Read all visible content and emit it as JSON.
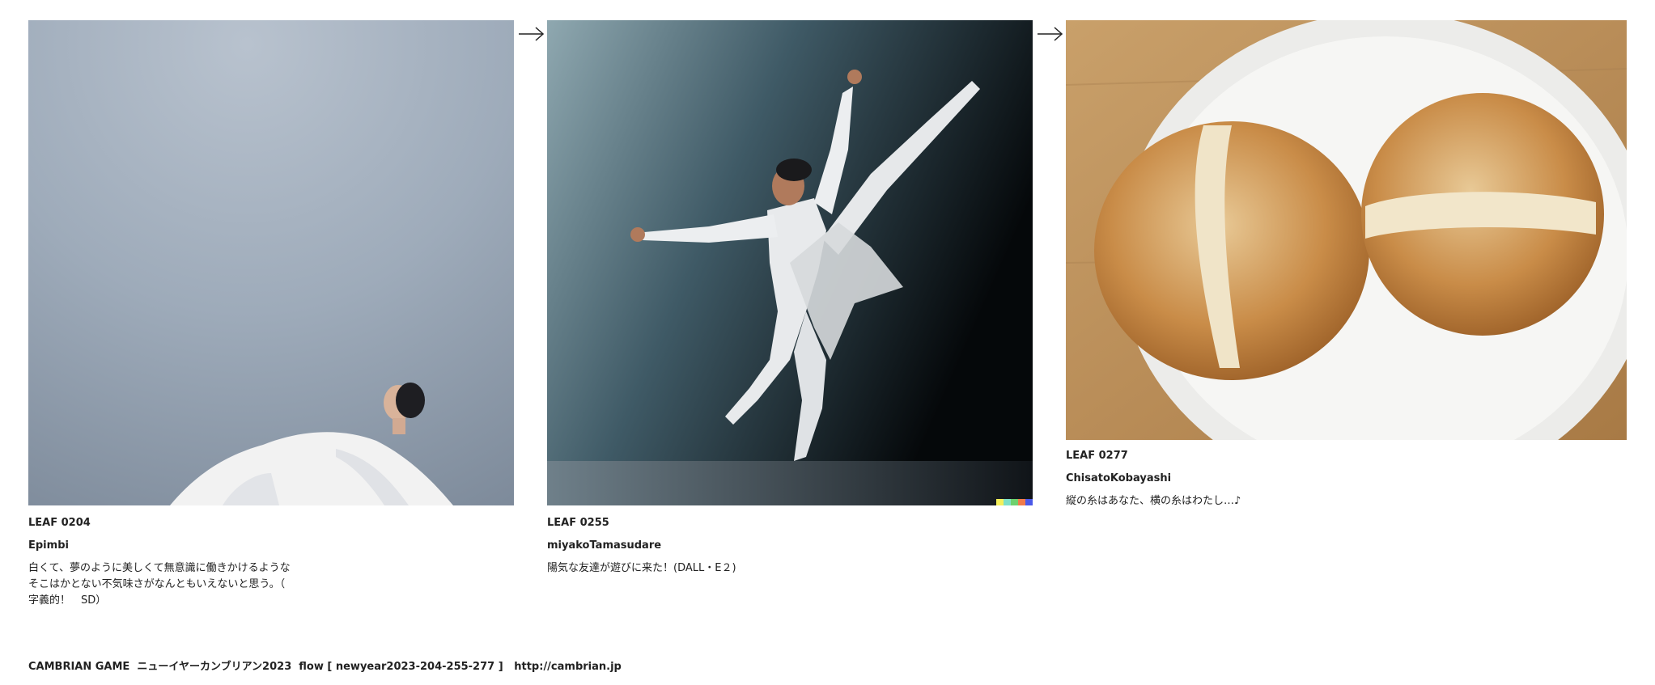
{
  "cards": [
    {
      "leaf": "LEAF 0204",
      "author": "Epimbi",
      "caption": "白くて、夢のように美しくて無意識に働きかけるような\nそこはかとない不気味さがなんともいえないと思う。（\n字義的！　SD）"
    },
    {
      "leaf": "LEAF 0255",
      "author": "miyakoTamasudare",
      "caption": "陽気な友達が遊びに来た！(DALL・E２)"
    },
    {
      "leaf": "LEAF 0277",
      "author": "ChisatoKobayashi",
      "caption": "縦の糸はあなた、横の糸はわたし…♪"
    }
  ],
  "footer": {
    "text": "CAMBRIAN GAME  ニューイヤーカンブリアン2023  flow [ newyear2023-204-255-277 ]   ",
    "link": "http://cambrian.jp"
  },
  "icons": {
    "arrow": "right-arrow-icon"
  }
}
